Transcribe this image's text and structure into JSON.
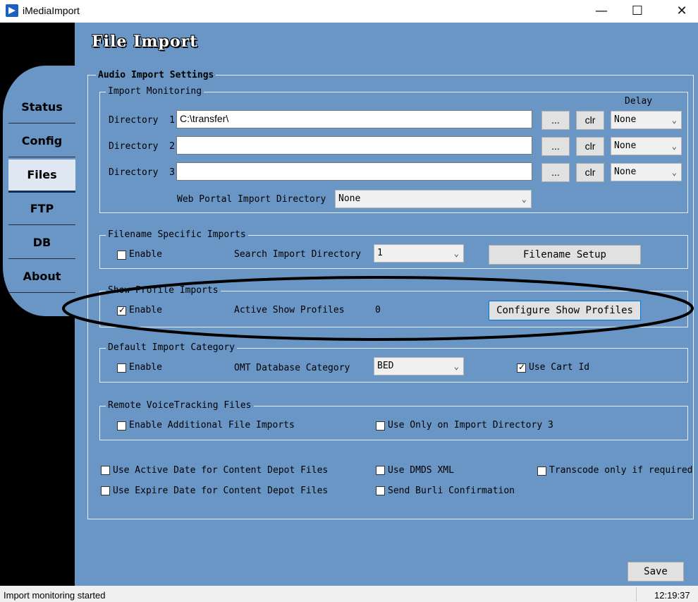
{
  "window": {
    "title": "iMediaImport"
  },
  "header": {
    "title": "File Import"
  },
  "nav": {
    "items": [
      "Status",
      "Config",
      "Files",
      "FTP",
      "DB",
      "About"
    ],
    "active": "Files"
  },
  "audio_import": {
    "title": "Audio Import Settings",
    "monitoring": {
      "title": "Import Monitoring",
      "delay_label": "Delay",
      "dir_label": "Directory",
      "dirs": [
        {
          "num": "1",
          "value": "C:\\transfer\\",
          "delay": "None"
        },
        {
          "num": "2",
          "value": "",
          "delay": "None"
        },
        {
          "num": "3",
          "value": "",
          "delay": "None"
        }
      ],
      "browse_label": "...",
      "clear_label": "clr",
      "web_portal_label": "Web Portal Import Directory",
      "web_portal_value": "None"
    },
    "filename_specific": {
      "title": "Filename Specific Imports",
      "enable_label": "Enable",
      "search_label": "Search Import Directory",
      "search_value": "1",
      "setup_button": "Filename Setup"
    },
    "show_profile": {
      "title": "Show Profile Imports",
      "enable_label": "Enable",
      "active_label": "Active Show Profiles",
      "active_count": "0",
      "configure_button": "Configure Show Profiles"
    },
    "default_category": {
      "title": "Default Import Category",
      "enable_label": "Enable",
      "category_label": "OMT Database Category",
      "category_value": "BED",
      "use_cart_label": "Use Cart Id"
    },
    "remote_vt": {
      "title": "Remote VoiceTracking Files",
      "additional_label": "Enable Additional File Imports",
      "only_dir3_label": "Use Only on Import Directory 3"
    },
    "options": {
      "active_date": "Use Active Date for Content Depot Files",
      "expire_date": "Use Expire Date for Content Depot Files",
      "dmds_xml": "Use DMDS XML",
      "burli": "Send Burli Confirmation",
      "transcode": "Transcode only if required"
    }
  },
  "save_button": "Save",
  "status": {
    "message": "Import monitoring started",
    "time": "12:19:37"
  }
}
